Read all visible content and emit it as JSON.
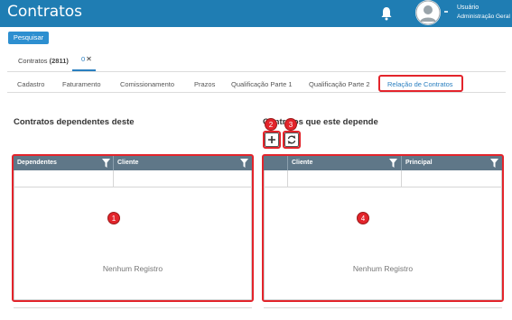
{
  "app": {
    "title": "Contratos"
  },
  "user": {
    "name": "Usuário",
    "role": "Administração Geral"
  },
  "toolbar": {
    "search_label": "Pesquisar"
  },
  "doc_tabs": [
    {
      "label": "Contratos",
      "count": "(2811)"
    },
    {
      "label": "0",
      "close": "✕"
    }
  ],
  "sub_tabs": [
    {
      "label": "Cadastro"
    },
    {
      "label": "Faturamento"
    },
    {
      "label": "Comissionamento"
    },
    {
      "label": "Prazos"
    },
    {
      "label": "Qualificação Parte 1"
    },
    {
      "label": "Qualificação Parte 2"
    },
    {
      "label": "Relação de Contratos",
      "active": true
    }
  ],
  "left_panel": {
    "title": "Contratos dependentes deste",
    "columns": [
      "Dependentes",
      "Cliente"
    ],
    "empty": "Nenhum Registro",
    "callout": "1"
  },
  "right_panel": {
    "title": "Contratos que este depende",
    "columns": [
      "",
      "Cliente",
      "Principal"
    ],
    "empty": "Nenhum Registro",
    "callout": "4",
    "add_callout": "2",
    "refresh_callout": "3",
    "add_icon": "plus-icon",
    "refresh_icon": "refresh-icon"
  },
  "colors": {
    "header": "#1f7db3",
    "accent": "#2a7fc0",
    "grid_header": "#5f7788",
    "callout": "#e3242b"
  }
}
